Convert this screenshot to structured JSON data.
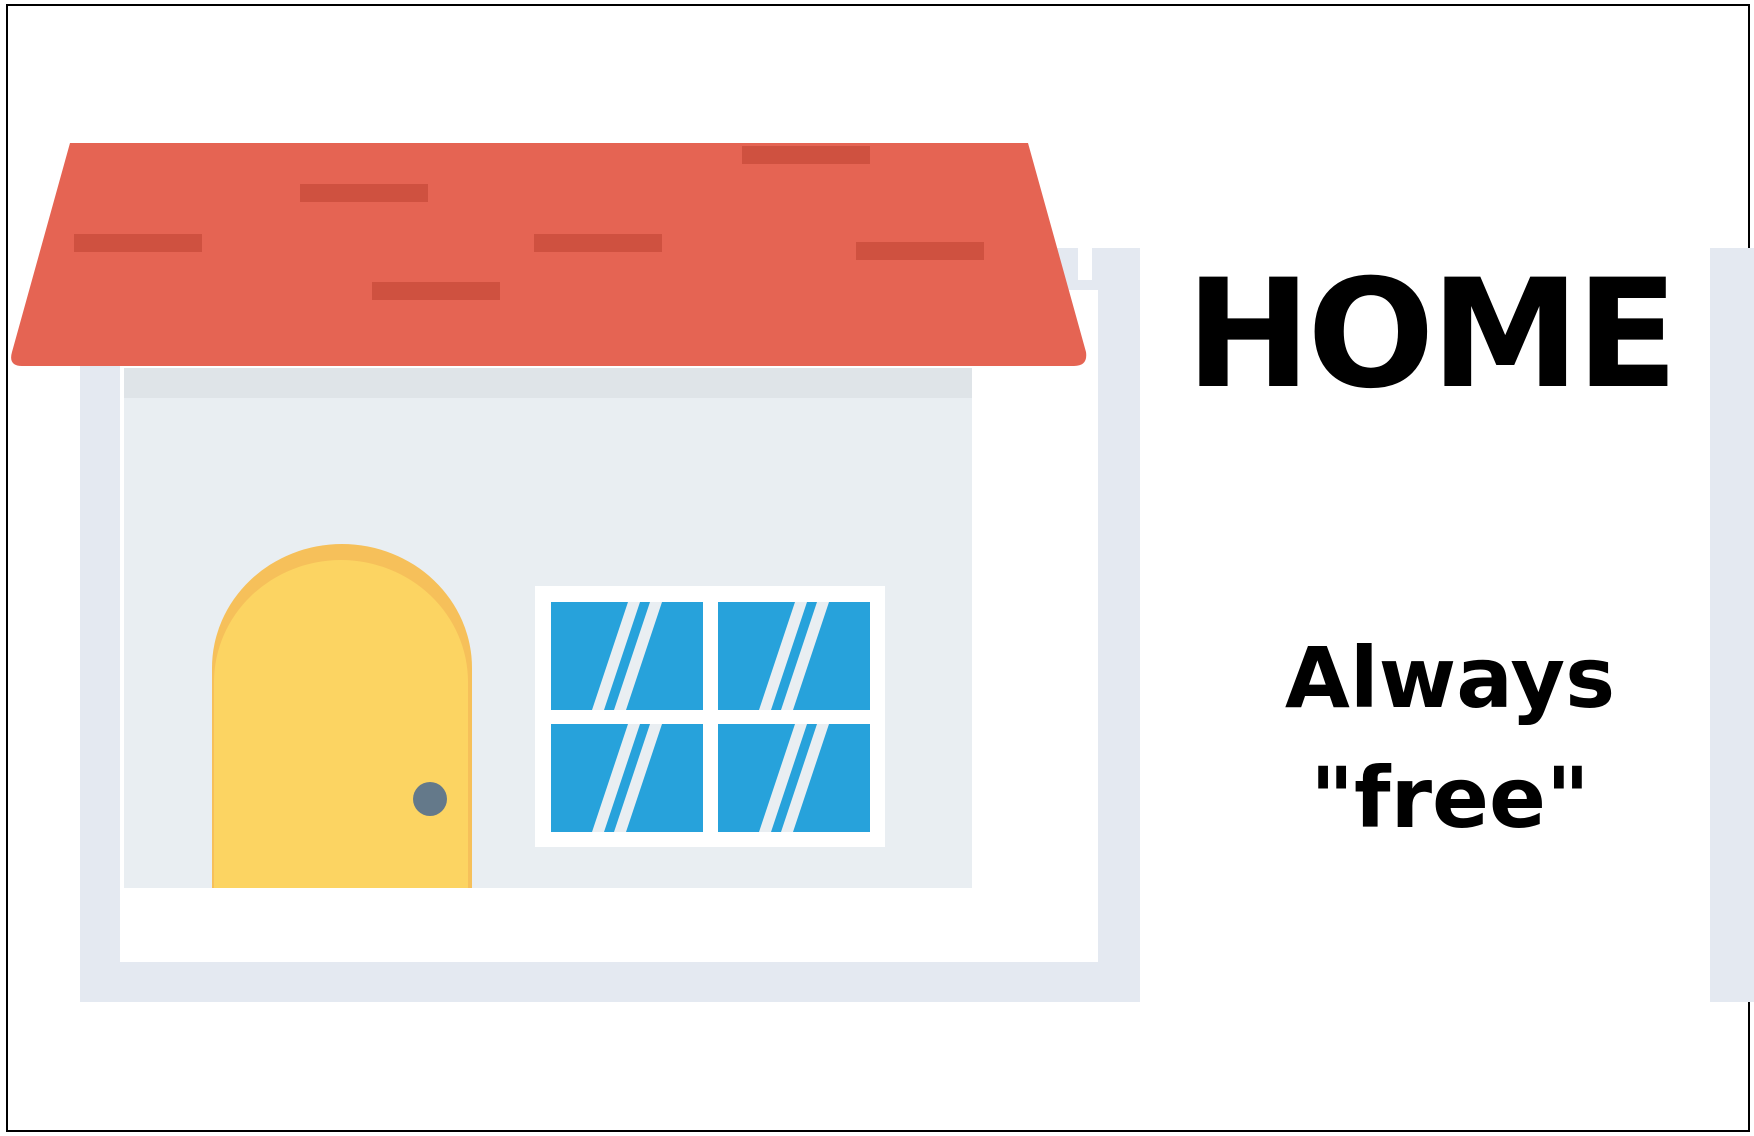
{
  "title": "HOME",
  "tagline": {
    "line1": "Always",
    "line2": "\"free\""
  },
  "colors": {
    "roof": "#e56453",
    "roof_shingle": "#cf5140",
    "wall": "#e9eef2",
    "wall_shadow": "#dfe4e8",
    "door": "#fcd462",
    "door_trim": "#f6c05a",
    "door_knob": "#64798a",
    "window_glass": "#27a2db",
    "window_frame": "#ffffff",
    "backdrop": "#e4e9f1",
    "text": "#000000"
  },
  "icons": {
    "house": "house-icon",
    "door": "door-icon",
    "window": "window-icon"
  }
}
